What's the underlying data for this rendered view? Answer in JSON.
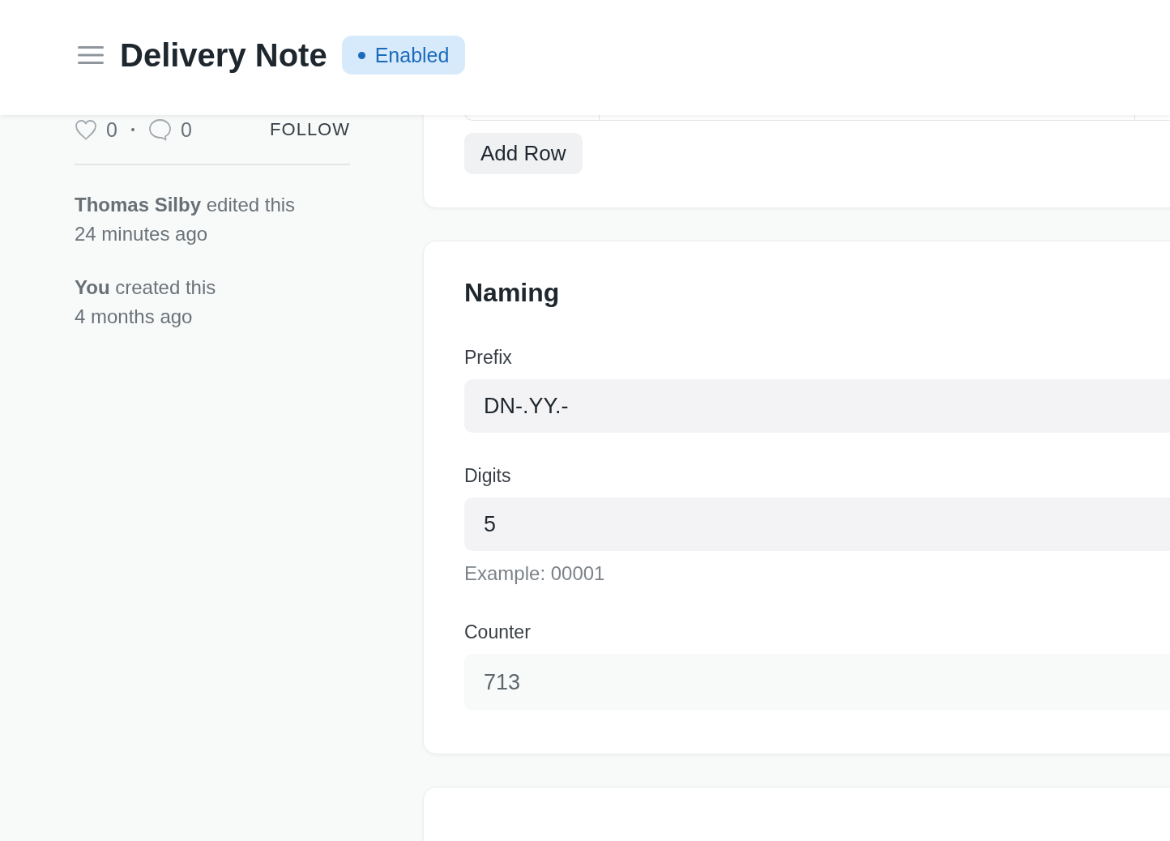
{
  "header": {
    "title": "Delivery Note",
    "status_badge": {
      "label": "Enabled"
    }
  },
  "sidebar": {
    "likes": "0",
    "comments": "0",
    "follow_link": "FOLLOW",
    "activity": [
      {
        "text": "**Thomas Silby** edited this",
        "time": "24 minutes ago"
      },
      {
        "text": "**You** created this",
        "time": "4 months ago"
      }
    ]
  },
  "sections": [
    {
      "kind": "table",
      "add_button": "Add Row"
    },
    {
      "kind": "form",
      "title": "Naming",
      "fields": [
        {
          "label": "Prefix",
          "value": "DN-.YY.-",
          "read_only": false
        },
        {
          "label": "Digits",
          "value": "5",
          "description": "Example: 00001",
          "read_only": false
        },
        {
          "label": "Counter",
          "value": "713",
          "read_only": true
        }
      ]
    },
    {
      "kind": "form"
    }
  ]
}
